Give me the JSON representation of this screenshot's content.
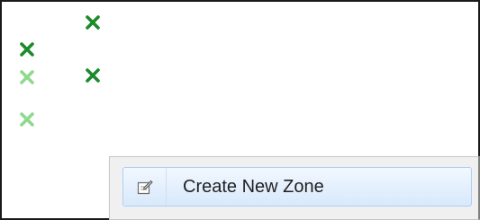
{
  "colors": {
    "marker_dark": "#1b8a2a",
    "marker_light": "#8fd98f",
    "menu_bg": "#f0f0f0",
    "menu_highlight": "#e3effd",
    "menu_highlight_border": "#aecff7"
  },
  "markers": [
    {
      "icon": "close-icon",
      "shade": "dark"
    },
    {
      "icon": "close-icon",
      "shade": "dark"
    },
    {
      "icon": "close-icon",
      "shade": "light"
    },
    {
      "icon": "close-icon",
      "shade": "dark"
    },
    {
      "icon": "close-icon",
      "shade": "light"
    }
  ],
  "context_menu": {
    "items": [
      {
        "label": "Create New Zone",
        "icon": "edit-note-icon",
        "highlighted": true
      }
    ]
  }
}
